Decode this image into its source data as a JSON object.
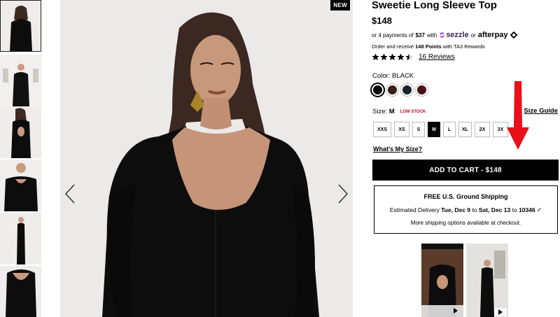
{
  "badge": "NEW",
  "product": {
    "title": "Sweetie Long Sleeve Top",
    "price": "$148",
    "installments": {
      "prefix": "or 4 payments of",
      "amount": "$37",
      "with": "with",
      "sezzle": "sezzle",
      "or": "or",
      "afterpay": "afterpay"
    },
    "rewards": {
      "prefix": "Order and receive",
      "points": "148 Points",
      "suffix": "with TA3 Rewards"
    },
    "rating": 4.5,
    "reviews_label": "16 Reviews",
    "color": {
      "label": "Color:",
      "value": "BLACK"
    },
    "swatches": [
      {
        "name": "black",
        "color": "#000000"
      },
      {
        "name": "brown",
        "color": "#3a1f17"
      },
      {
        "name": "navy",
        "color": "#1d2230"
      },
      {
        "name": "burgundy",
        "color": "#4a1218"
      }
    ],
    "size": {
      "label": "Size:",
      "value": "M",
      "stock": "LOW STOCK",
      "guide": "Size Guide"
    },
    "sizes": [
      "XXS",
      "XS",
      "S",
      "M",
      "L",
      "XL",
      "2X",
      "3X"
    ],
    "selected_size": "M",
    "whats_my_size": "What's My Size?",
    "add_to_cart": "ADD TO CART - $148"
  },
  "shipping": {
    "title": "FREE U.S. Ground Shipping",
    "est_prefix": "Estimated Delivery",
    "date_from": "Tue, Dec 9",
    "to1": "to",
    "date_to": "Sat, Dec 13",
    "to2": "to",
    "zip": "10346",
    "more": "More shipping options available at checkout."
  },
  "colors": {
    "accent": "#000000",
    "low_stock": "#d0021b",
    "annotation_arrow": "#e8101a"
  }
}
